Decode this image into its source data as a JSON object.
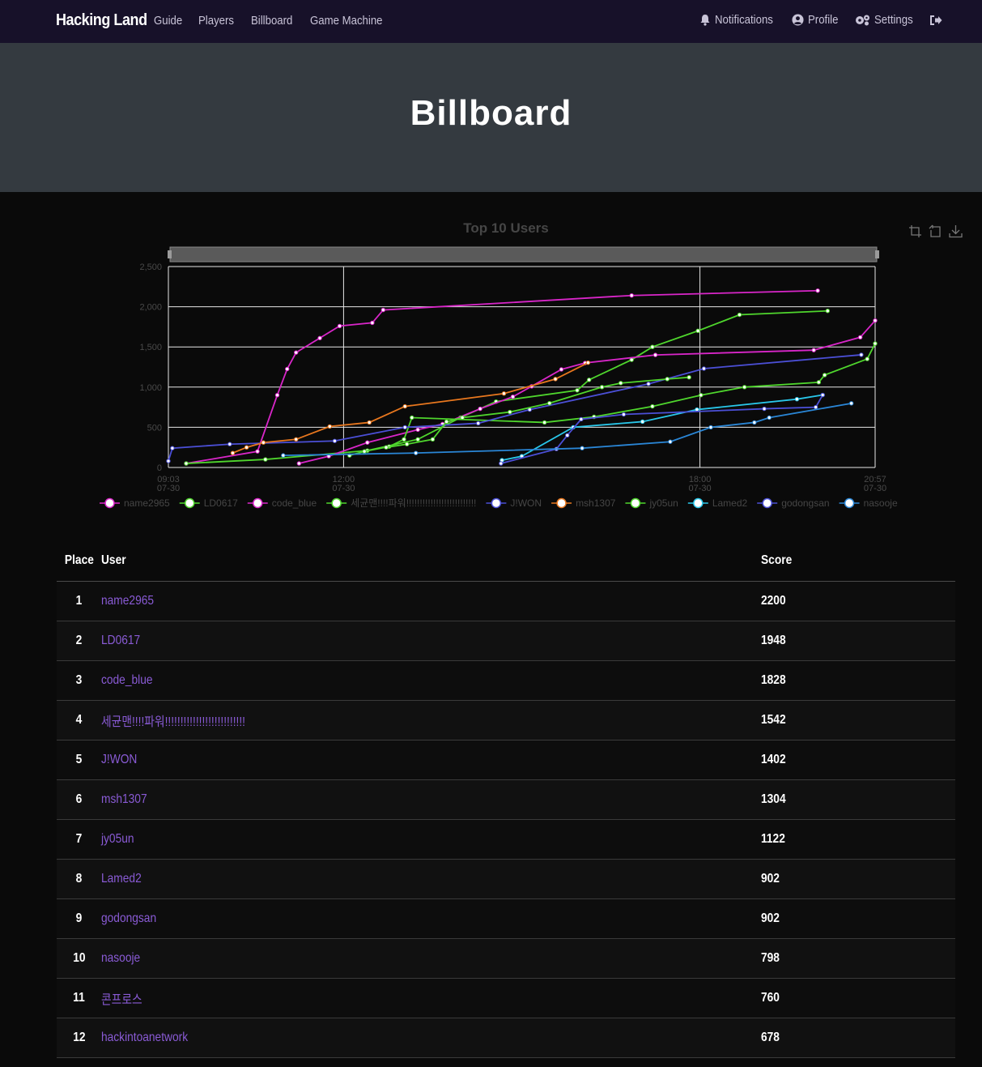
{
  "navbar": {
    "brand": "Hacking Land",
    "links": [
      "Guide",
      "Players",
      "Billboard",
      "Game Machine"
    ],
    "notifications": "Notifications",
    "profile": "Profile",
    "settings": "Settings"
  },
  "hero": {
    "title": "Billboard"
  },
  "chart_data": {
    "type": "line",
    "title": "Top 10 Users",
    "ylim": [
      0,
      2500
    ],
    "yticks": [
      "0",
      "500",
      "1,000",
      "1,500",
      "2,000",
      "2,500"
    ],
    "xlim": [
      "07-30 09:03",
      "07-30 20:57"
    ],
    "xticks": [
      {
        "time": "09:03",
        "date": "07-30"
      },
      {
        "time": "12:00",
        "date": "07-30"
      },
      {
        "time": "18:00",
        "date": "07-30"
      },
      {
        "time": "20:57",
        "date": "07-30"
      }
    ],
    "grid": true,
    "legend_position": "bottom",
    "series": [
      {
        "name": "name2965",
        "color": "#d926c9",
        "points": [
          [
            "07-30 09:21",
            50
          ],
          [
            "07-30 10:33",
            200
          ],
          [
            "07-30 10:53",
            900
          ],
          [
            "07-30 11:03",
            1225
          ],
          [
            "07-30 11:12",
            1430
          ],
          [
            "07-30 11:36",
            1610
          ],
          [
            "07-30 11:56",
            1760
          ],
          [
            "07-30 12:29",
            1800
          ],
          [
            "07-30 12:40",
            1960
          ],
          [
            "07-30 16:51",
            2140
          ],
          [
            "07-30 19:59",
            2200
          ]
        ]
      },
      {
        "name": "LD0617",
        "color": "#4fd62d",
        "points": [
          [
            "07-30 09:21",
            50
          ],
          [
            "07-30 10:41",
            100
          ],
          [
            "07-30 12:24",
            210
          ],
          [
            "07-30 13:15",
            350
          ],
          [
            "07-30 13:58",
            620
          ],
          [
            "07-30 14:34",
            820
          ],
          [
            "07-30 15:56",
            960
          ],
          [
            "07-30 16:08",
            1090
          ],
          [
            "07-30 16:51",
            1340
          ],
          [
            "07-30 17:12",
            1500
          ],
          [
            "07-30 17:58",
            1700
          ],
          [
            "07-30 18:40",
            1900
          ],
          [
            "07-30 20:09",
            1948
          ]
        ]
      },
      {
        "name": "code_blue",
        "color": "#d926c9",
        "points": [
          [
            "07-30 11:15",
            50
          ],
          [
            "07-30 11:45",
            140
          ],
          [
            "07-30 12:24",
            310
          ],
          [
            "07-30 13:15",
            470
          ],
          [
            "07-30 13:40",
            540
          ],
          [
            "07-30 14:18",
            730
          ],
          [
            "07-30 14:51",
            880
          ],
          [
            "07-30 15:10",
            1010
          ],
          [
            "07-30 15:40",
            1220
          ],
          [
            "07-30 16:04",
            1300
          ],
          [
            "07-30 17:15",
            1400
          ],
          [
            "07-30 19:55",
            1460
          ],
          [
            "07-30 20:42",
            1620
          ],
          [
            "07-30 20:57",
            1828
          ]
        ]
      },
      {
        "name": "세균맨!!!!파워!!!!!!!!!!!!!!!!!!!!!!!!!!",
        "color": "#4fd62d",
        "points": [
          [
            "07-30 12:06",
            150
          ],
          [
            "07-30 12:21",
            200
          ],
          [
            "07-30 12:46",
            260
          ],
          [
            "07-30 13:01",
            350
          ],
          [
            "07-30 13:09",
            620
          ],
          [
            "07-30 15:23",
            560
          ],
          [
            "07-30 16:13",
            630
          ],
          [
            "07-30 17:12",
            760
          ],
          [
            "07-30 18:01",
            900
          ],
          [
            "07-30 18:45",
            1000
          ],
          [
            "07-30 20:00",
            1060
          ],
          [
            "07-30 20:06",
            1150
          ],
          [
            "07-30 20:49",
            1350
          ],
          [
            "07-30 20:57",
            1542
          ]
        ]
      },
      {
        "name": "J!WON",
        "color": "#4b4fd6",
        "points": [
          [
            "07-30 09:03",
            80
          ],
          [
            "07-30 09:07",
            240
          ],
          [
            "07-30 10:05",
            290
          ],
          [
            "07-30 11:51",
            330
          ],
          [
            "07-30 13:02",
            500
          ],
          [
            "07-30 14:16",
            550
          ],
          [
            "07-30 15:08",
            720
          ],
          [
            "07-30 17:08",
            1040
          ],
          [
            "07-30 18:04",
            1230
          ],
          [
            "07-30 20:43",
            1402
          ]
        ]
      },
      {
        "name": "msh1307",
        "color": "#e8771e",
        "points": [
          [
            "07-30 10:08",
            180
          ],
          [
            "07-30 10:22",
            250
          ],
          [
            "07-30 10:39",
            310
          ],
          [
            "07-30 11:12",
            350
          ],
          [
            "07-30 11:46",
            510
          ],
          [
            "07-30 12:26",
            560
          ],
          [
            "07-30 13:02",
            760
          ],
          [
            "07-30 14:42",
            920
          ],
          [
            "07-30 15:34",
            1100
          ],
          [
            "07-30 16:07",
            1304
          ]
        ]
      },
      {
        "name": "jy05un",
        "color": "#4fd62d",
        "points": [
          [
            "07-30 12:43",
            250
          ],
          [
            "07-30 13:04",
            290
          ],
          [
            "07-30 13:30",
            350
          ],
          [
            "07-30 13:44",
            570
          ],
          [
            "07-30 14:00",
            620
          ],
          [
            "07-30 14:48",
            690
          ],
          [
            "07-30 15:28",
            800
          ],
          [
            "07-30 16:21",
            1000
          ],
          [
            "07-30 16:40",
            1050
          ],
          [
            "07-30 17:27",
            1100
          ],
          [
            "07-30 17:49",
            1122
          ]
        ]
      },
      {
        "name": "Lamed2",
        "color": "#29c7ea",
        "points": [
          [
            "07-30 14:40",
            90
          ],
          [
            "07-30 15:00",
            140
          ],
          [
            "07-30 15:52",
            500
          ],
          [
            "07-30 17:02",
            570
          ],
          [
            "07-30 17:57",
            720
          ],
          [
            "07-30 19:38",
            850
          ],
          [
            "07-30 20:04",
            902
          ]
        ]
      },
      {
        "name": "godongsan",
        "color": "#4b4fd6",
        "points": [
          [
            "07-30 14:39",
            50
          ],
          [
            "07-30 15:35",
            230
          ],
          [
            "07-30 15:46",
            400
          ],
          [
            "07-30 16:00",
            600
          ],
          [
            "07-30 16:43",
            660
          ],
          [
            "07-30 19:05",
            730
          ],
          [
            "07-30 19:57",
            750
          ],
          [
            "07-30 20:04",
            902
          ]
        ]
      },
      {
        "name": "nasooje",
        "color": "#2a86d6",
        "points": [
          [
            "07-30 10:59",
            150
          ],
          [
            "07-30 13:13",
            180
          ],
          [
            "07-30 16:01",
            240
          ],
          [
            "07-30 17:30",
            320
          ],
          [
            "07-30 18:11",
            500
          ],
          [
            "07-30 18:55",
            560
          ],
          [
            "07-30 19:10",
            620
          ],
          [
            "07-30 20:33",
            798
          ]
        ]
      }
    ]
  },
  "leaderboard": {
    "headers": {
      "place": "Place",
      "user": "User",
      "score": "Score"
    },
    "rows": [
      {
        "place": "1",
        "user": "name2965",
        "score": "2200"
      },
      {
        "place": "2",
        "user": "LD0617",
        "score": "1948"
      },
      {
        "place": "3",
        "user": "code_blue",
        "score": "1828"
      },
      {
        "place": "4",
        "user": "세균맨!!!!파워!!!!!!!!!!!!!!!!!!!!!!!!!!",
        "score": "1542"
      },
      {
        "place": "5",
        "user": "J!WON",
        "score": "1402"
      },
      {
        "place": "6",
        "user": "msh1307",
        "score": "1304"
      },
      {
        "place": "7",
        "user": "jy05un",
        "score": "1122"
      },
      {
        "place": "8",
        "user": "Lamed2",
        "score": "902"
      },
      {
        "place": "9",
        "user": "godongsan",
        "score": "902"
      },
      {
        "place": "10",
        "user": "nasooje",
        "score": "798"
      },
      {
        "place": "11",
        "user": "콘프로스",
        "score": "760"
      },
      {
        "place": "12",
        "user": "hackintoanetwork",
        "score": "678"
      }
    ]
  }
}
